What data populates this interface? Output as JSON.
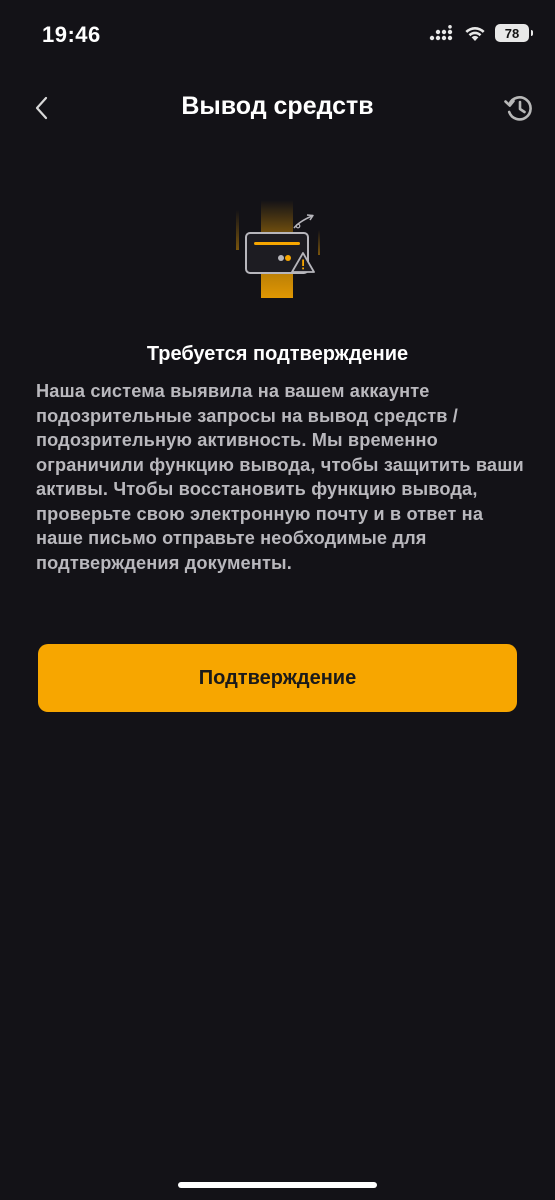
{
  "status_bar": {
    "time": "19:46",
    "battery_level": "78",
    "icons": [
      "signal-icon",
      "wifi-icon",
      "battery-icon"
    ]
  },
  "nav": {
    "title": "Вывод средств",
    "back_icon": "chevron-left-icon",
    "history_icon": "history-icon"
  },
  "illustration": {
    "icon": "card-warning-icon",
    "accent_color": "#f7a600"
  },
  "notice": {
    "title": "Требуется подтверждение",
    "body": "Наша система выявила на вашем аккаунте подозрительные запросы на вывод средств / подозрительную активность. Мы временно ограничили функцию вывода, чтобы защитить ваши активы. Чтобы восстановить функцию вывода, проверьте свою электронную почту и в ответ на наше письмо отправьте необходимые для подтверждения документы."
  },
  "actions": {
    "confirm_label": "Подтверждение"
  },
  "colors": {
    "background": "#131217",
    "accent": "#f7a600",
    "body_text": "#b9b8bd"
  }
}
